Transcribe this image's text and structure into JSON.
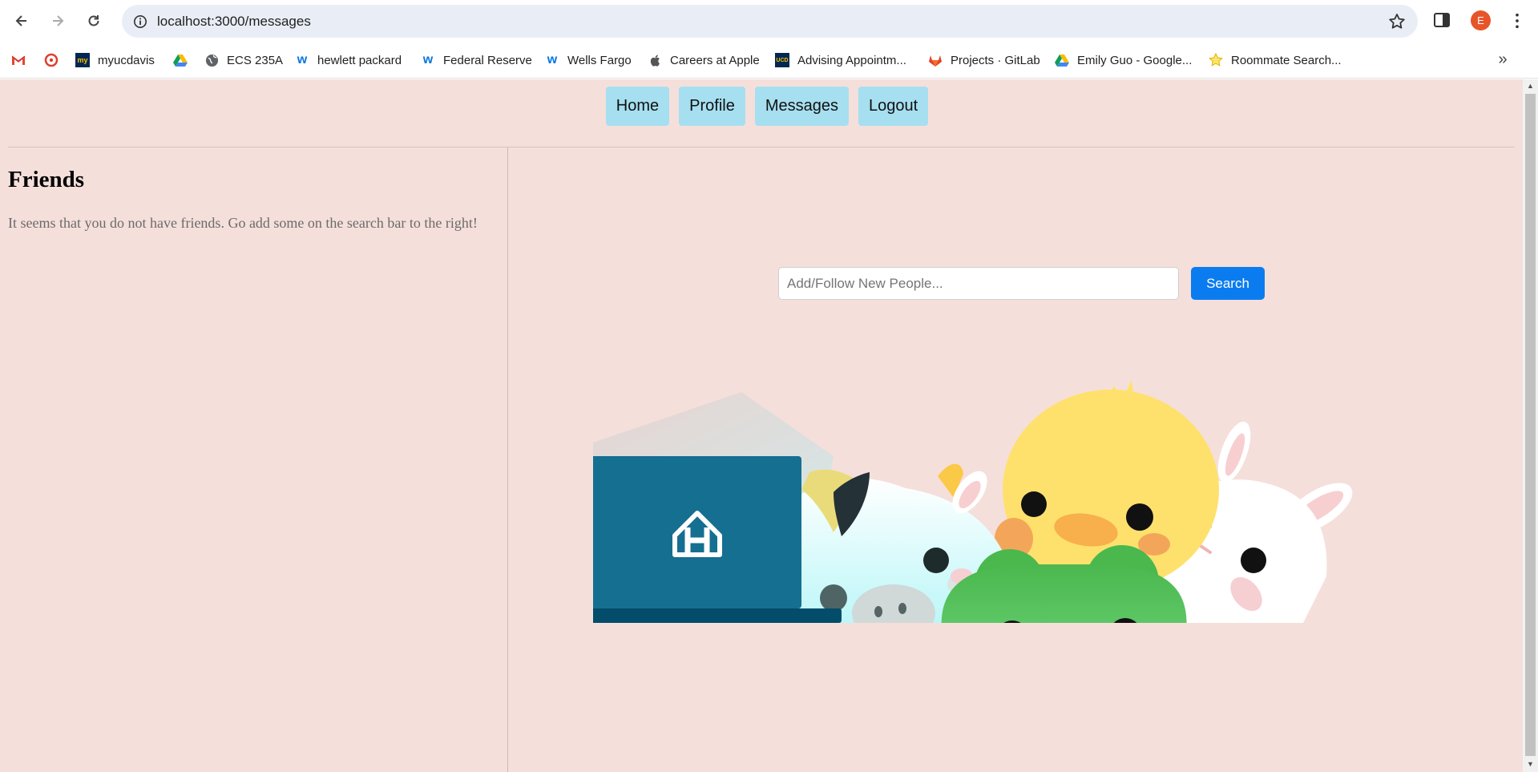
{
  "browser": {
    "url": "localhost:3000/messages",
    "profile_initial": "E",
    "bookmarks": [
      {
        "label": "",
        "icon": "gmail-icon"
      },
      {
        "label": "",
        "icon": "canvas-icon"
      },
      {
        "label": "myucdavis",
        "icon": "myucdavis-icon"
      },
      {
        "label": "",
        "icon": "google-drive-icon"
      },
      {
        "label": "ECS 235A",
        "icon": "globe-icon"
      },
      {
        "label": "hewlett packard",
        "icon": "workday-icon"
      },
      {
        "label": "Federal Reserve",
        "icon": "workday-icon"
      },
      {
        "label": "Wells Fargo",
        "icon": "workday-icon"
      },
      {
        "label": "Careers at Apple",
        "icon": "apple-icon"
      },
      {
        "label": "Advising Appointm...",
        "icon": "ucd-icon"
      },
      {
        "label": "Projects · GitLab",
        "icon": "gitlab-icon"
      },
      {
        "label": "Emily Guo - Google...",
        "icon": "google-drive-icon"
      },
      {
        "label": "Roommate Search...",
        "icon": "star-icon"
      }
    ]
  },
  "nav": {
    "home": "Home",
    "profile": "Profile",
    "messages": "Messages",
    "logout": "Logout"
  },
  "friends": {
    "title": "Friends",
    "empty_message": "It seems that you do not have friends. Go add some on the search bar to the right!"
  },
  "search": {
    "placeholder": "Add/Follow New People...",
    "button_label": "Search"
  },
  "colors": {
    "page_background": "#f5dfdb",
    "nav_button": "#a6dff0",
    "search_button": "#0b7cf0",
    "laptop": "#156f90"
  }
}
